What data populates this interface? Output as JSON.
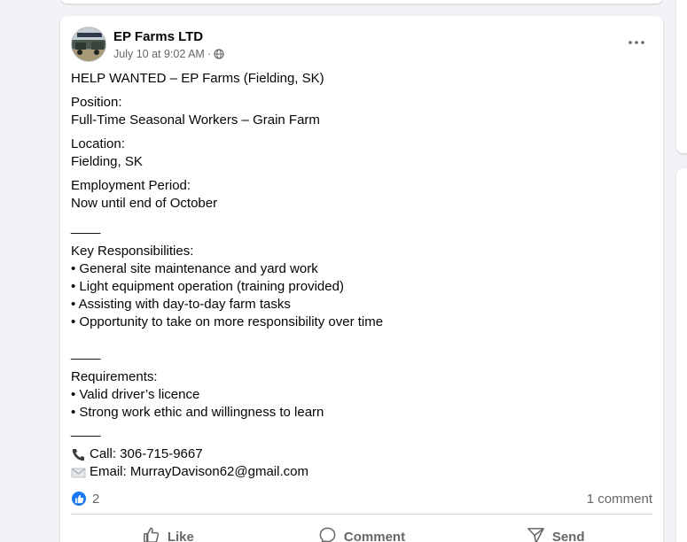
{
  "post": {
    "author": "EP Farms LTD",
    "timestamp": "July 10 at 9:02 AM",
    "separator": "·",
    "privacy_icon": "globe-icon",
    "title": "HELP WANTED – EP Farms (Fielding, SK)",
    "position_label": "Position:",
    "position_value": "Full-Time Seasonal Workers – Grain Farm",
    "location_label": "Location:",
    "location_value": "Fielding, SK",
    "period_label": "Employment Period:",
    "period_value": "Now until end of October",
    "divider_text": "____",
    "responsibilities_label": "Key Responsibilities:",
    "responsibilities": [
      "• General site maintenance and yard work",
      "• Light equipment operation (training provided)",
      "• Assisting with day-to-day farm tasks",
      "• Opportunity to take on more responsibility over time"
    ],
    "requirements_label": "Requirements:",
    "requirements": [
      "• Valid driver’s licence",
      "• Strong work ethic and willingness to learn"
    ],
    "call_text": "Call: 306-715-9667",
    "email_text": "Email: MurrayDavison62@gmail.com"
  },
  "engagement": {
    "reaction_count": "2",
    "comment_count": "1 comment"
  },
  "actions": {
    "like": "Like",
    "comment": "Comment",
    "send": "Send"
  },
  "colors": {
    "accent": "#1877f2",
    "secondary_text": "#65676b",
    "background": "#f0f2f5"
  }
}
